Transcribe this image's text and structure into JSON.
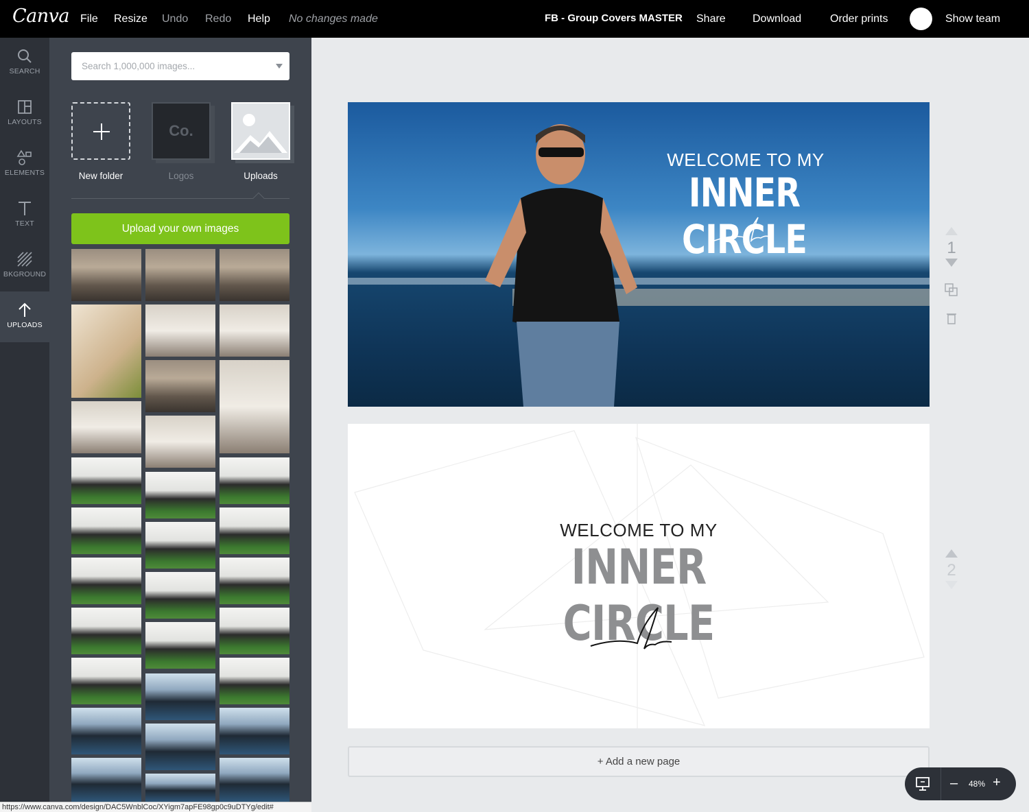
{
  "topbar": {
    "logo": "Canva",
    "menu": {
      "file": "File",
      "resize": "Resize",
      "undo": "Undo",
      "redo": "Redo",
      "help": "Help"
    },
    "status": "No changes made",
    "design_title": "FB - Group Covers MASTER",
    "share": "Share",
    "download": "Download",
    "order_prints": "Order prints",
    "show_team": "Show team"
  },
  "leftnav": {
    "items": [
      {
        "label": "SEARCH",
        "icon": "search-icon"
      },
      {
        "label": "LAYOUTS",
        "icon": "layouts-icon"
      },
      {
        "label": "ELEMENTS",
        "icon": "elements-icon"
      },
      {
        "label": "TEXT",
        "icon": "text-icon"
      },
      {
        "label": "BKGROUND",
        "icon": "background-icon"
      },
      {
        "label": "UPLOADS",
        "icon": "upload-icon",
        "active": true
      }
    ]
  },
  "panel": {
    "search_placeholder": "Search 1,000,000 images...",
    "folders": {
      "new_folder": "New folder",
      "logos": "Logos",
      "logos_mark": "Co.",
      "uploads": "Uploads"
    },
    "upload_button": "Upload your own images"
  },
  "canvas": {
    "page1": {
      "welcome": "WELCOME TO MY",
      "title": "INNER CIRCLE",
      "page_number": "1"
    },
    "page2": {
      "welcome": "WELCOME TO MY",
      "title": "INNER CIRCLE",
      "page_number": "2"
    },
    "add_page": "+ Add a new page"
  },
  "zoom": {
    "value": "48%",
    "minus": "–",
    "plus": "+"
  },
  "statusbar": {
    "url": "https://www.canva.com/design/DAC5WnblCoc/XYigm7apFE98gp0c9uDTYg/edit#"
  },
  "colors": {
    "topbar_bg": "#000000",
    "nav_bg": "#2d3138",
    "panel_bg": "#3e444d",
    "upload_green": "#7ec31b",
    "canvas_bg": "#e8eaec"
  }
}
